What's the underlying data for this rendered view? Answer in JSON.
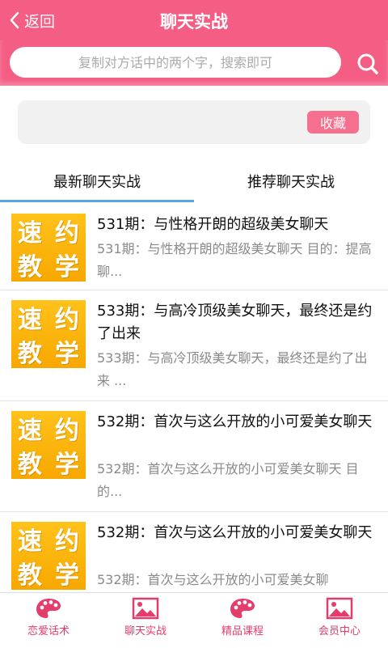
{
  "header": {
    "back_label": "返回",
    "title": "聊天实战"
  },
  "search": {
    "placeholder": "复制对方话中的两个字，搜索即可",
    "icon": "search-icon"
  },
  "favorites": {
    "button_label": "收藏"
  },
  "tabs": [
    {
      "label": "最新聊天实战",
      "active": true
    },
    {
      "label": "推荐聊天实战",
      "active": false
    }
  ],
  "thumbnail_text": [
    "速",
    "约",
    "教",
    "学"
  ],
  "items": [
    {
      "title": "531期：与性格开朗的超级美女聊天",
      "desc": "531期：与性格开朗的超级美女聊天 目的：提高聊..."
    },
    {
      "title": "533期：与高冷顶级美女聊天，最终还是约了出来",
      "desc": "533期：与高冷顶级美女聊天，最终还是约了出来 ..."
    },
    {
      "title": "532期：首次与这么开放的小可爱美女聊天",
      "desc": "532期：首次与这么开放的小可爱美女聊天 目的..."
    },
    {
      "title": "532期：首次与这么开放的小可爱美女聊天",
      "desc": "532期：首次与这么开放的小可爱美女聊"
    }
  ],
  "bottom_nav": [
    {
      "label": "恋爱话术",
      "icon": "palette-icon"
    },
    {
      "label": "聊天实战",
      "icon": "picture-icon"
    },
    {
      "label": "精品课程",
      "icon": "palette-icon"
    },
    {
      "label": "会员中心",
      "icon": "picture-icon"
    }
  ],
  "colors": {
    "brand": "#f45d84",
    "tab_indicator": "#5aa4e6",
    "thumbnail": "#ffb400"
  }
}
